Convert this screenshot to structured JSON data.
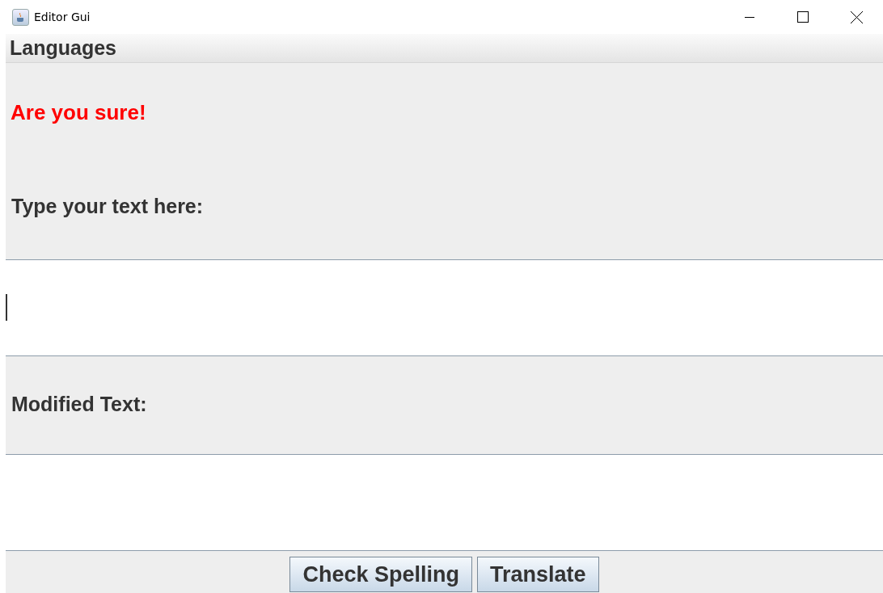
{
  "window": {
    "title": "Editor Gui"
  },
  "menu_bar": {
    "items": [
      "Languages"
    ]
  },
  "warning": "Are you sure!",
  "input_label": "Type your text here:",
  "input": {
    "focused": true
  },
  "output_label": "Modified Text:",
  "buttons": [
    "Check Spelling",
    "Translate"
  ]
}
